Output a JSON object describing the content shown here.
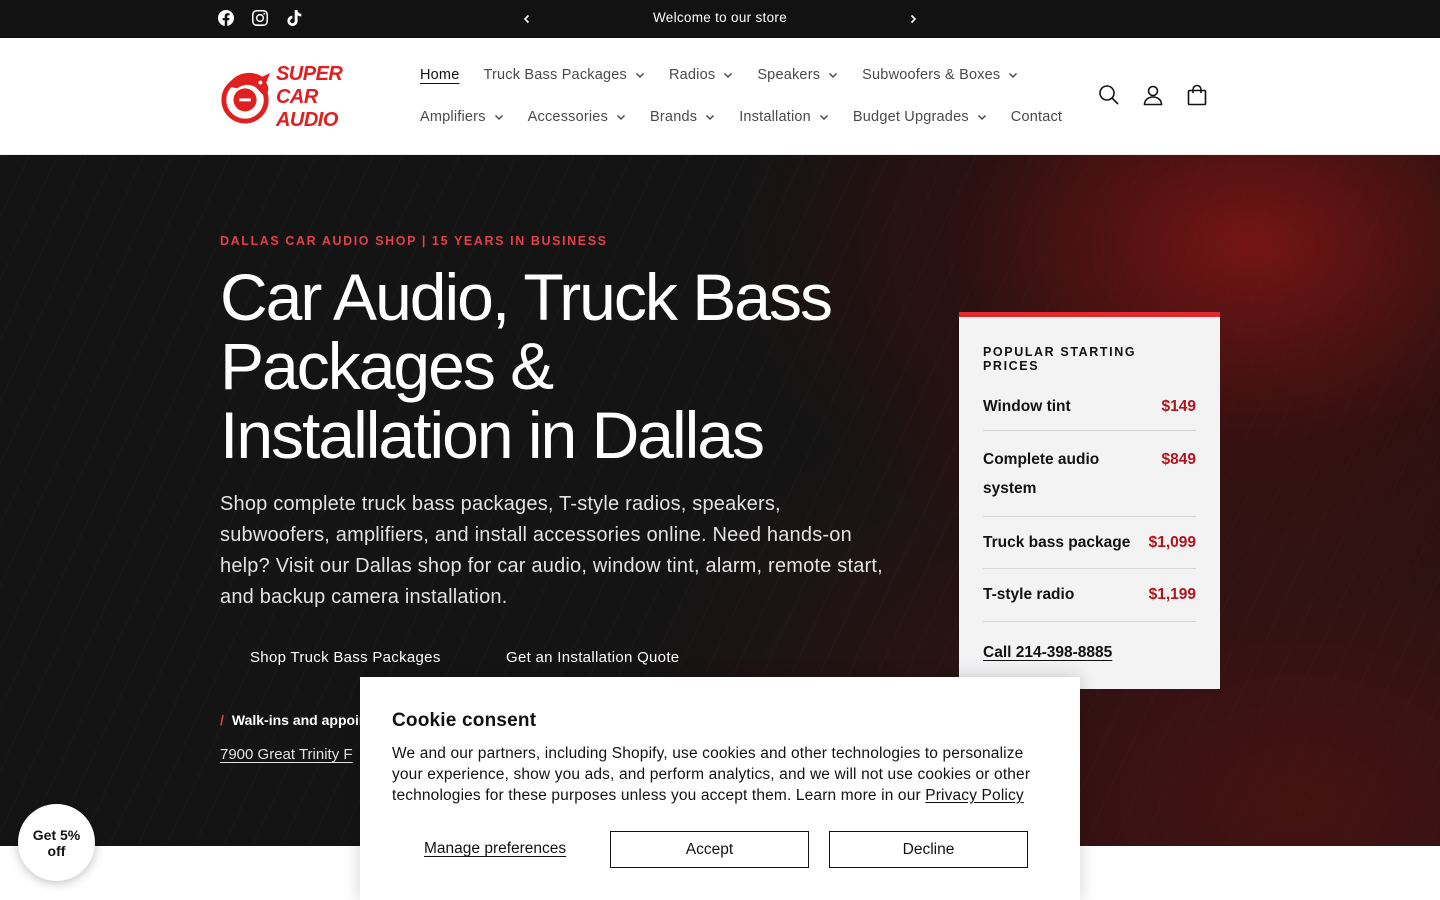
{
  "announcement": {
    "text": "Welcome to our store",
    "social_icons": [
      "facebook-icon",
      "instagram-icon",
      "tiktok-icon"
    ],
    "prev_icon": "chevron-left-icon",
    "next_icon": "chevron-right-icon"
  },
  "header": {
    "logo_line1": "SUPER",
    "logo_line2": "CAR AUDIO",
    "nav_row1": [
      {
        "label": "Home",
        "dropdown": false,
        "active": true
      },
      {
        "label": "Truck Bass Packages",
        "dropdown": true
      },
      {
        "label": "Radios",
        "dropdown": true
      },
      {
        "label": "Speakers",
        "dropdown": true
      },
      {
        "label": "Subwoofers & Boxes",
        "dropdown": true
      }
    ],
    "nav_row2": [
      {
        "label": "Amplifiers",
        "dropdown": true
      },
      {
        "label": "Accessories",
        "dropdown": true
      },
      {
        "label": "Brands",
        "dropdown": true
      },
      {
        "label": "Installation",
        "dropdown": true
      },
      {
        "label": "Budget Upgrades",
        "dropdown": true
      },
      {
        "label": "Contact",
        "dropdown": false
      }
    ],
    "icons": [
      "search-icon",
      "account-icon",
      "cart-icon"
    ]
  },
  "hero": {
    "eyebrow": "DALLAS CAR AUDIO SHOP | 15 YEARS IN BUSINESS",
    "title": "Car Audio, Truck Bass Packages & Installation in Dallas",
    "description": "Shop complete truck bass packages, T-style radios, speakers, subwoofers, amplifiers, and install accessories online. Need hands-on help? Visit our Dallas shop for car audio, window tint, alarm, remote start, and backup camera installation.",
    "button_primary": "Shop Truck Bass Packages",
    "button_secondary": "Get an Installation Quote",
    "walkins_slash": "/",
    "walkins_text": "Walk-ins and appoin",
    "address": "7900 Great Trinity F"
  },
  "price_card": {
    "title": "POPULAR STARTING PRICES",
    "rows": [
      {
        "label": "Window tint",
        "price": "$149"
      },
      {
        "label": "Complete audio system",
        "price": "$849"
      },
      {
        "label": "Truck bass package",
        "price": "$1,099"
      },
      {
        "label": "T-style radio",
        "price": "$1,199"
      }
    ],
    "call": "Call 214-398-8885"
  },
  "cookie": {
    "title": "Cookie consent",
    "text": "We and our partners, including Shopify, use cookies and other technologies to personalize your experience, show you ads, and perform analytics, and we will not use cookies or other technologies for these purposes unless you accept them. Learn more in our ",
    "privacy_link": "Privacy Policy",
    "manage": "Manage preferences",
    "accept": "Accept",
    "decline": "Decline"
  },
  "discount": {
    "label": "Get 5% off"
  },
  "colors": {
    "accent_red": "#e02a2f",
    "price_red": "#b0141c",
    "dark": "#121212"
  }
}
